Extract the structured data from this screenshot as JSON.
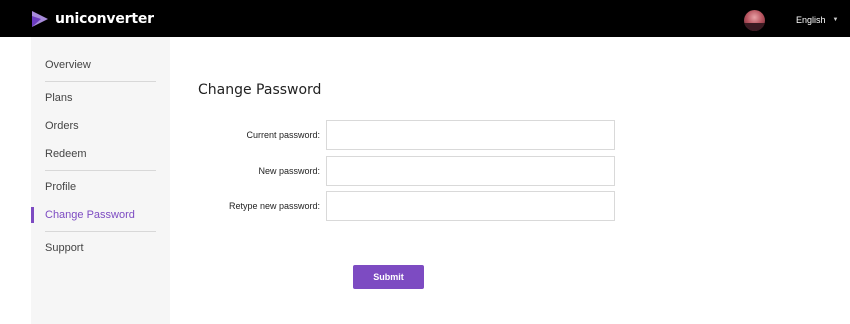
{
  "header": {
    "brand": "uniconverter",
    "language": "English",
    "icons": {
      "logo": "play-triangle-icon",
      "avatar": "user-avatar",
      "caret": "chevron-down-icon"
    },
    "colors": {
      "background": "#000000",
      "logo_light": "#a78bda",
      "logo_dark": "#6a3bbf"
    }
  },
  "sidebar": {
    "items": [
      {
        "label": "Overview"
      },
      {
        "label": "Plans"
      },
      {
        "label": "Orders"
      },
      {
        "label": "Redeem"
      },
      {
        "label": "Profile"
      },
      {
        "label": "Change Password",
        "active": true
      },
      {
        "label": "Support"
      }
    ],
    "accent": "#7d4bc2"
  },
  "main": {
    "title": "Change Password",
    "fields": [
      {
        "label": "Current password:",
        "value": ""
      },
      {
        "label": "New password:",
        "value": ""
      },
      {
        "label": "Retype new password:",
        "value": ""
      }
    ],
    "submit_label": "Submit",
    "submit_color": "#7d4bc2"
  }
}
